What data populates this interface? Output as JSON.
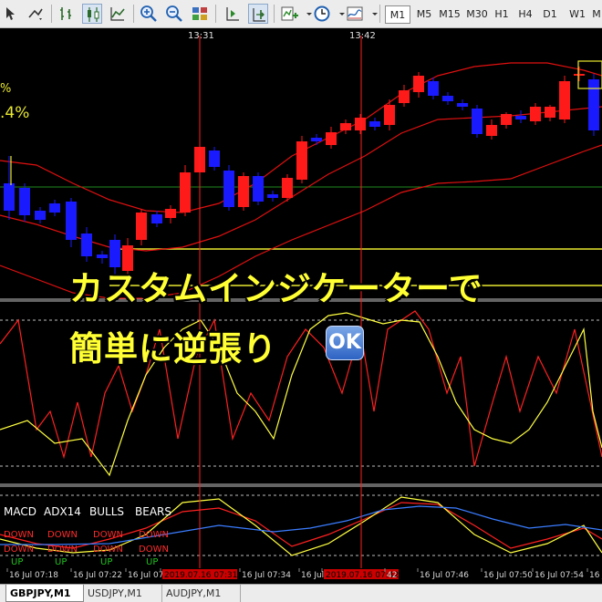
{
  "toolbar": {
    "timeframes": [
      "M1",
      "M5",
      "M15",
      "M30",
      "H1",
      "H4",
      "D1",
      "W1"
    ],
    "active_timeframe": "M1"
  },
  "chart": {
    "top_time_labels": [
      "13:31",
      "13:42"
    ],
    "pct_label": ".4%",
    "pct_label_above": "%",
    "indicator_labels": [
      "MACD",
      "ADX14",
      "BULLS",
      "BEARS"
    ],
    "signal_rows": {
      "row1": [
        "DOWN",
        "DOWN",
        "DOWN",
        "DOWN"
      ],
      "row2": [
        "DOWN",
        "DOWN",
        "DOWN",
        "DOWN"
      ],
      "row3": [
        "UP",
        "UP",
        "UP",
        "UP"
      ]
    },
    "time_axis": [
      {
        "label": "16 Jul 07:18",
        "hl": false
      },
      {
        "label": "16 Jul 07:22",
        "hl": false
      },
      {
        "label": "16 Jul 07:",
        "hl": false
      },
      {
        "label": "2019.07.16 07:31",
        "hl": true
      },
      {
        "label": "16 Jul 07:34",
        "hl": false
      },
      {
        "label": "16 Jul 07:38",
        "hl": false
      },
      {
        "label": "2019.07.16 07:42",
        "hl": true
      },
      {
        "label": "42",
        "hl": false
      },
      {
        "label": "16 Jul 07:46",
        "hl": false
      },
      {
        "label": "16 Jul 07:50",
        "hl": false
      },
      {
        "label": "16 Jul 07:54",
        "hl": false
      },
      {
        "label": "16 J",
        "hl": false
      }
    ]
  },
  "overlay": {
    "line1": "カスタムインジケーターで",
    "line2": "簡単に逆張り",
    "badge": "OK"
  },
  "tabs": [
    "GBPJPY,M1",
    "USDJPY,M1",
    "AUDJPY,M1"
  ],
  "colors": {
    "bull": "#ff1a1a",
    "bear": "#1a1aff",
    "band": "#e01010",
    "signal_yellow": "#ffff33",
    "highlight": "#cc0000"
  }
}
